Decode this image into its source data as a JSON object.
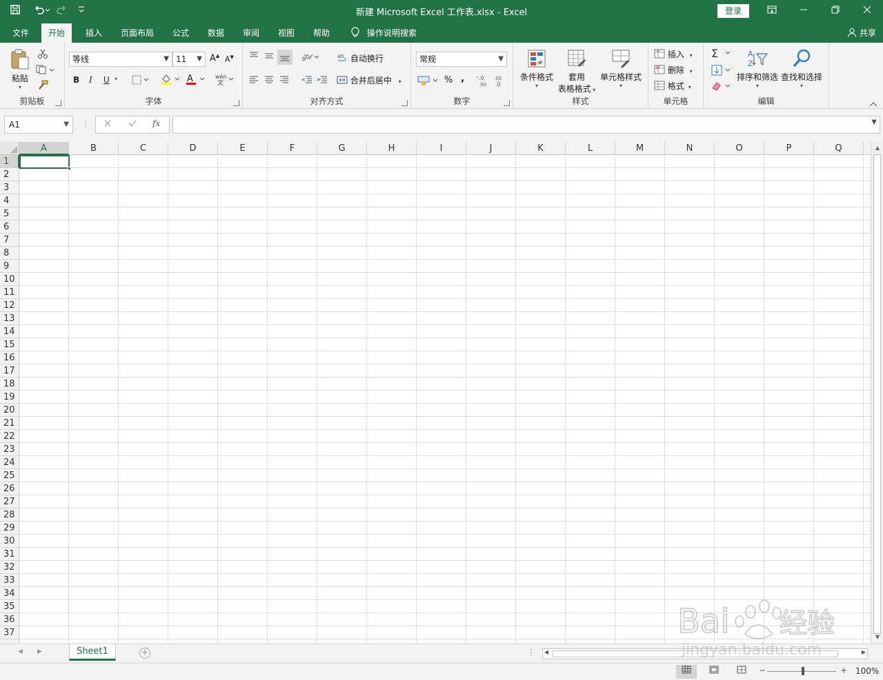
{
  "title_bar": {
    "title": "新建 Microsoft Excel 工作表.xlsx  -  Excel",
    "login_label": "登录",
    "qat_icons": [
      "save-icon",
      "undo-icon",
      "redo-icon",
      "customize-icon"
    ],
    "window_icons": [
      "ribbon-display-icon",
      "minimize-icon",
      "restore-icon",
      "close-icon"
    ]
  },
  "menu": {
    "tabs": [
      "文件",
      "开始",
      "插入",
      "页面布局",
      "公式",
      "数据",
      "审阅",
      "视图",
      "帮助"
    ],
    "active_tab": "开始",
    "tell_me": "操作说明搜索",
    "share": "共享"
  },
  "ribbon": {
    "clipboard": {
      "label": "剪贴板",
      "paste": "粘贴"
    },
    "font": {
      "label": "字体",
      "font_name": "等线",
      "font_size": "11",
      "bold": "B",
      "italic": "I",
      "underline": "U"
    },
    "alignment": {
      "label": "对齐方式",
      "wrap_text": "自动换行",
      "merge_center": "合并后居中"
    },
    "number": {
      "label": "数字",
      "format": "常规",
      "percent": "%",
      "comma": ","
    },
    "styles": {
      "label": "样式",
      "conditional": "条件格式",
      "table_format_1": "套用",
      "table_format_2": "表格格式",
      "cell_styles": "单元格样式"
    },
    "cells": {
      "label": "单元格",
      "insert": "插入",
      "delete": "删除",
      "format": "格式"
    },
    "editing": {
      "label": "编辑",
      "sort_filter": "排序和筛选",
      "find_select": "查找和选择"
    }
  },
  "formula_bar": {
    "name_box": "A1",
    "fx": "fx",
    "value": ""
  },
  "grid": {
    "columns": [
      "A",
      "B",
      "C",
      "D",
      "E",
      "F",
      "G",
      "H",
      "I",
      "J",
      "K",
      "L",
      "M",
      "N",
      "O",
      "P",
      "Q"
    ],
    "rows": [
      "1",
      "2",
      "3",
      "4",
      "5",
      "6",
      "7",
      "8",
      "9",
      "10",
      "11",
      "12",
      "13",
      "14",
      "15",
      "16",
      "17",
      "18",
      "19",
      "20",
      "21",
      "22",
      "23",
      "24",
      "25",
      "26",
      "27",
      "28",
      "29",
      "30",
      "31",
      "32",
      "33",
      "34",
      "35",
      "36",
      "37"
    ],
    "active_cell": "A1"
  },
  "sheets": {
    "tabs": [
      "Sheet1"
    ],
    "active": "Sheet1"
  },
  "status_bar": {
    "zoom": "100%"
  },
  "watermark": {
    "brand": "Bai",
    "brand_cn": "经验",
    "url": "jingyan.baidu.com"
  },
  "colors": {
    "accent": "#217346",
    "ribbon_bg": "#f3f3f3",
    "gridline": "#e1e1e1"
  }
}
